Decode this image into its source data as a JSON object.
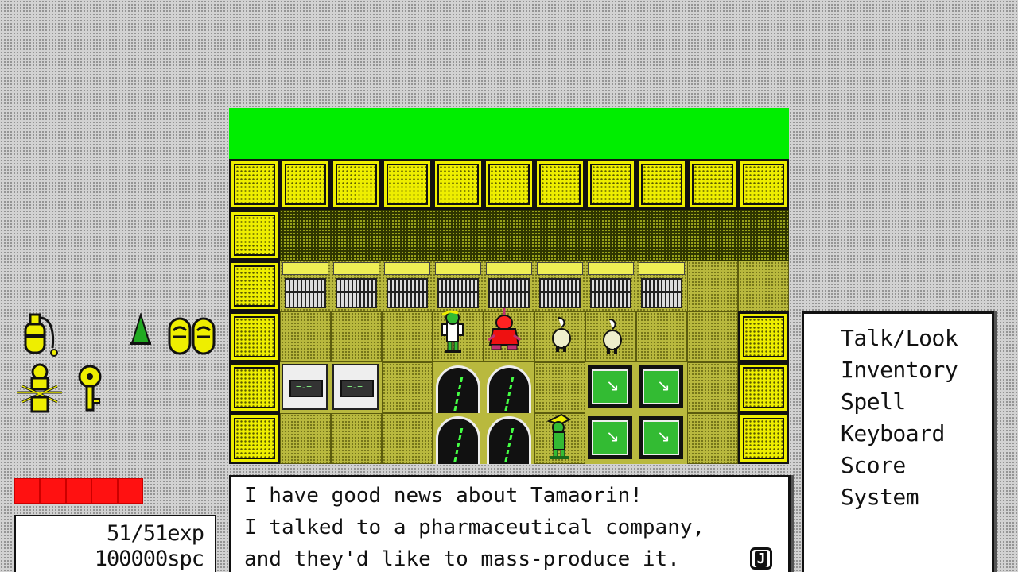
{
  "menu": {
    "items": [
      {
        "label": "Talk/Look"
      },
      {
        "label": "Inventory"
      },
      {
        "label": "Spell"
      },
      {
        "label": "Keyboard"
      },
      {
        "label": "Score"
      },
      {
        "label": "System"
      }
    ]
  },
  "dialog": {
    "lines": [
      "I have good news about Tamaorin!",
      "I talked to a pharmaceutical company,",
      "and they'd like to mass-produce it."
    ],
    "next_key": "J"
  },
  "stats": {
    "exp": "51/51exp",
    "spc": "100000spc"
  },
  "health": {
    "segments_filled": 5,
    "segments_total": 5
  },
  "inventory_icons": [
    "oxygen-tank-icon",
    "cone-icon",
    "slippers-icon",
    "figurine-icon",
    "key-icon"
  ],
  "colors": {
    "sky": "#00ee00",
    "wall": "#eeee00",
    "health": "#ff1111"
  }
}
